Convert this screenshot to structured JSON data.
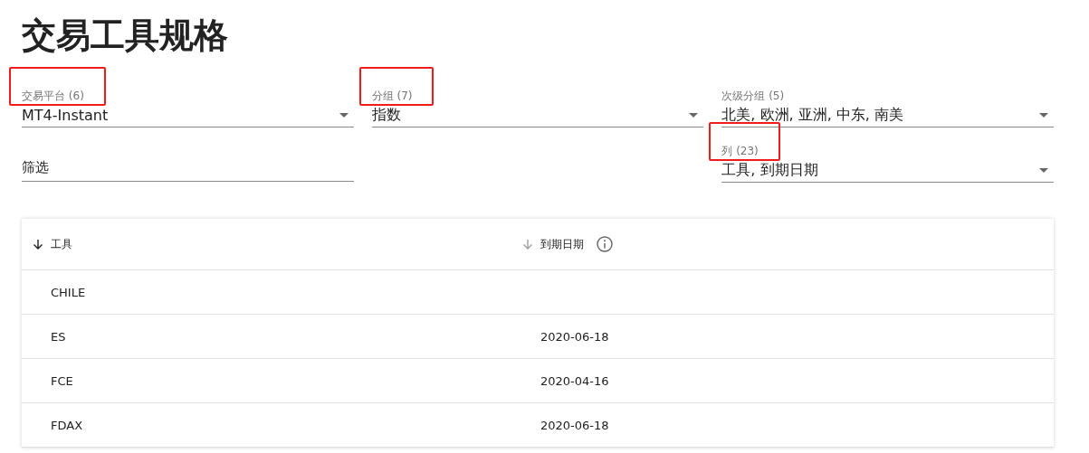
{
  "title": "交易工具规格",
  "fields": [
    {
      "kind": "select",
      "label": "交易平台 (6)",
      "value": "MT4-Instant",
      "highlighted": true
    },
    {
      "kind": "select",
      "label": "分组 (7)",
      "value": "指数",
      "highlighted": true
    },
    {
      "kind": "select",
      "label": "次级分组 (5)",
      "value": "北美, 欧洲, 亚洲, 中东, 南美",
      "highlighted": false
    },
    {
      "kind": "text",
      "placeholder": "筛选"
    },
    {
      "kind": "spacer"
    },
    {
      "kind": "select",
      "label": "列 (23)",
      "value": "工具, 到期日期",
      "highlighted": true
    }
  ],
  "table": {
    "columns": [
      {
        "label": "工具",
        "sorted": true,
        "info": false
      },
      {
        "label": "到期日期",
        "sorted": false,
        "info": true
      }
    ],
    "rows": [
      {
        "instrument": "CHILE"
      },
      {
        "instrument": "ES",
        "expiry": "2020-06-18"
      },
      {
        "instrument": "FCE",
        "expiry": "2020-04-16"
      },
      {
        "instrument": "FDAX",
        "expiry": "2020-06-18"
      }
    ]
  }
}
